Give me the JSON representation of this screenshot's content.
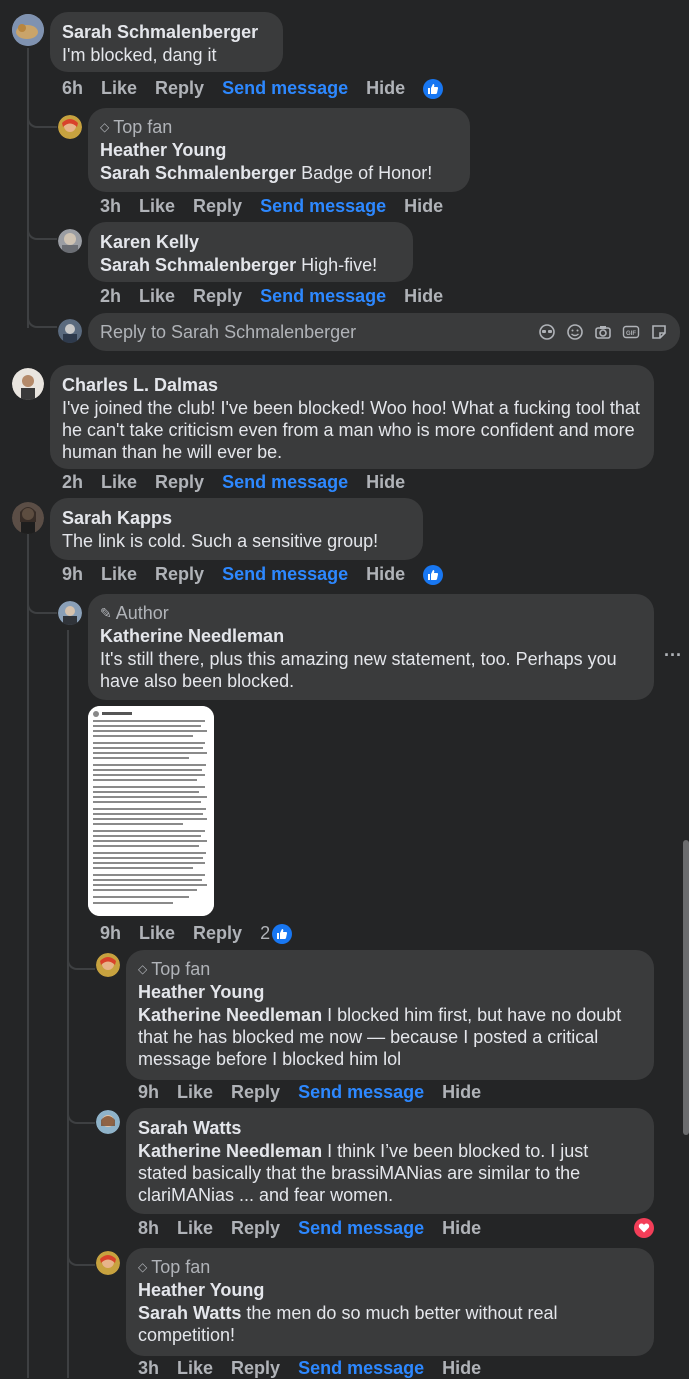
{
  "colors": {
    "bg": "#242526",
    "bubble": "#3a3b3c",
    "text": "#e4e6eb",
    "muted": "#b0b3b8",
    "link": "#2d88ff",
    "like": "#1877f2",
    "love": "#f33e58"
  },
  "c1": {
    "name": "Sarah Schmalenberger",
    "text": "I'm blocked, dang it",
    "time": "6h",
    "like": "Like",
    "reply": "Reply",
    "send": "Send message",
    "hide": "Hide"
  },
  "c1r1": {
    "badge": "Top fan",
    "name": "Heather Young",
    "mention": "Sarah Schmalenberger",
    "text": "Badge of Honor!",
    "time": "3h",
    "like": "Like",
    "reply": "Reply",
    "send": "Send message",
    "hide": "Hide"
  },
  "c1r2": {
    "name": "Karen Kelly",
    "mention": "Sarah Schmalenberger",
    "text": "High-five!",
    "time": "2h",
    "like": "Like",
    "reply": "Reply",
    "send": "Send message",
    "hide": "Hide"
  },
  "replybox": {
    "placeholder": "Reply to Sarah Schmalenberger"
  },
  "c2": {
    "name": "Charles L. Dalmas",
    "text": "I've joined the club! I've been blocked! Woo hoo! What a fucking tool that he can't take criticism even from a man who is more confident and more human than he will ever be.",
    "time": "2h",
    "like": "Like",
    "reply": "Reply",
    "send": "Send message",
    "hide": "Hide"
  },
  "c3": {
    "name": "Sarah Kapps",
    "text": "The link is cold. Such a sensitive group!",
    "time": "9h",
    "like": "Like",
    "reply": "Reply",
    "send": "Send message",
    "hide": "Hide"
  },
  "c3r1": {
    "badge": "Author",
    "name": "Katherine Needleman",
    "text": "It's still there, plus this amazing new statement, too. Perhaps you have also been blocked.",
    "time": "9h",
    "like": "Like",
    "reply": "Reply",
    "reactions": "2",
    "more": "..."
  },
  "c3r1r1": {
    "badge": "Top fan",
    "name": "Heather Young",
    "mention": "Katherine Needleman",
    "text": "I blocked him first, but have no doubt that he has blocked me now — because I posted a critical message before I blocked him lol",
    "time": "9h",
    "like": "Like",
    "reply": "Reply",
    "send": "Send message",
    "hide": "Hide"
  },
  "c3r1r2": {
    "name": "Sarah Watts",
    "mention": "Katherine Needleman",
    "text": "I think I’ve been blocked to. I just stated basically that the brassiMANias are similar to the clariMANias ... and fear women.",
    "time": "8h",
    "like": "Like",
    "reply": "Reply",
    "send": "Send message",
    "hide": "Hide"
  },
  "c3r1r3": {
    "badge": "Top fan",
    "name": "Heather Young",
    "mention": "Sarah Watts",
    "text": "the men do so much better without real competition!",
    "time": "3h",
    "like": "Like",
    "reply": "Reply",
    "send": "Send message",
    "hide": "Hide"
  }
}
